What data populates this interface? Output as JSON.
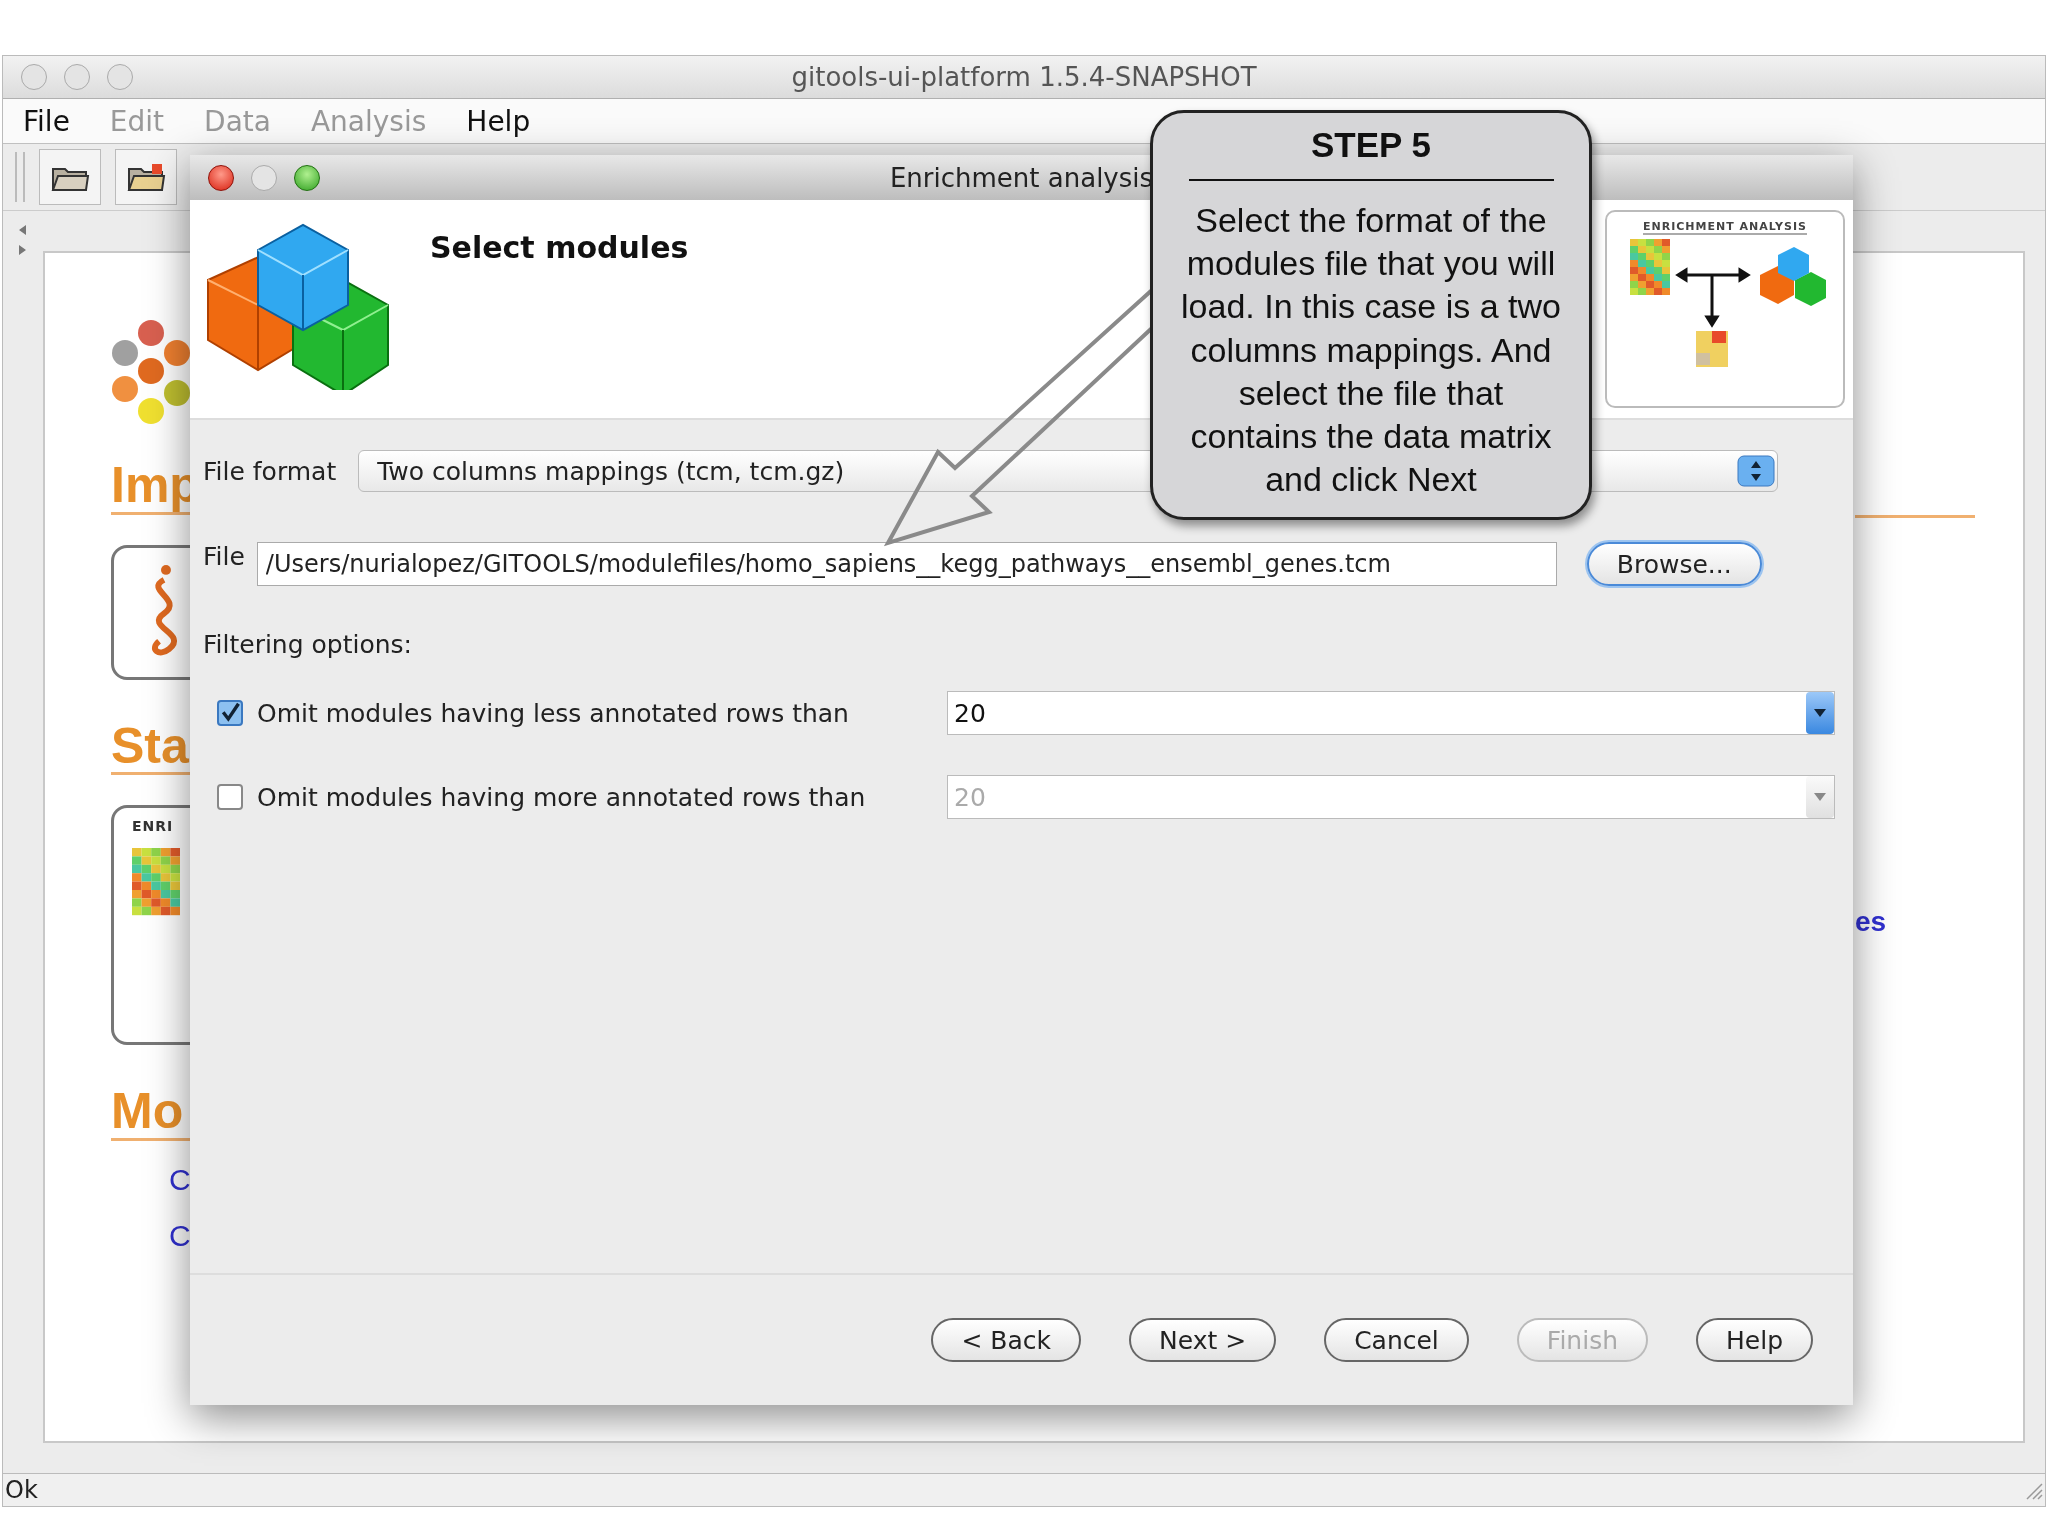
{
  "window": {
    "title": "gitools-ui-platform 1.5.4-SNAPSHOT"
  },
  "menu": [
    {
      "label": "File",
      "disabled": false
    },
    {
      "label": "Edit",
      "disabled": true
    },
    {
      "label": "Data",
      "disabled": true
    },
    {
      "label": "Analysis",
      "disabled": true
    },
    {
      "label": "Help",
      "disabled": false
    }
  ],
  "background_page": {
    "headings": [
      "Imp",
      "Sta",
      "Mo"
    ],
    "card_label": "ENRI",
    "links": [
      "C",
      "C"
    ],
    "right_link": "es"
  },
  "dialog": {
    "title": "Enrichment analysis",
    "heading": "Select modules",
    "logo_caption": "ENRICHMENT ANALYSIS",
    "file_format": {
      "label": "File format",
      "value": "Two columns mappings (tcm, tcm.gz)"
    },
    "file": {
      "label": "File",
      "value": "/Users/nurialopez/GITOOLS/modulefiles/homo_sapiens__kegg_pathways__ensembl_genes.tcm",
      "button": "Browse..."
    },
    "filtering_label": "Filtering options:",
    "filters": [
      {
        "label": "Omit modules having less annotated rows than",
        "checked": true,
        "value": "20"
      },
      {
        "label": "Omit modules having more annotated rows than",
        "checked": false,
        "value": "20"
      }
    ],
    "buttons": [
      {
        "label": "< Back",
        "disabled": false
      },
      {
        "label": "Next >",
        "disabled": false
      },
      {
        "label": "Cancel",
        "disabled": false
      },
      {
        "label": "Finish",
        "disabled": true
      },
      {
        "label": "Help",
        "disabled": false
      }
    ]
  },
  "callout": {
    "title": "STEP 5",
    "text": "Select the format of the modules file that you will load. In this case is a two columns mappings. And select the file that contains the data matrix and click Next"
  },
  "status_bar": "Ok"
}
